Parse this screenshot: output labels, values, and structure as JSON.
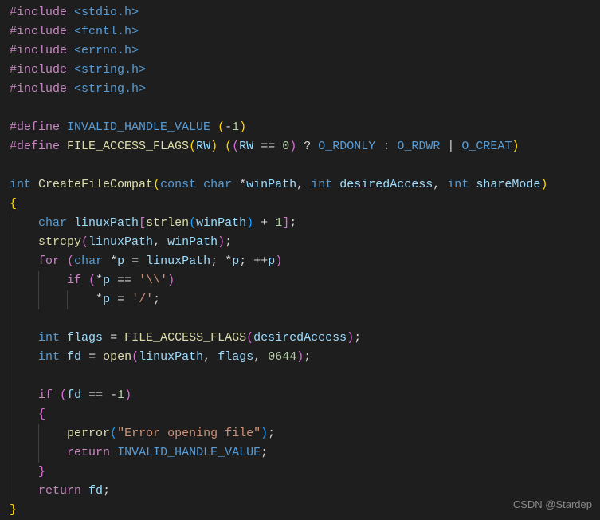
{
  "includes": [
    "<stdio.h>",
    "<fcntl.h>",
    "<errno.h>",
    "<string.h>",
    "<string.h>"
  ],
  "define1": {
    "kw": "#define",
    "name": "INVALID_HANDLE_VALUE",
    "val": "(-1)"
  },
  "define2": {
    "kw": "#define",
    "name": "FILE_ACCESS_FLAGS",
    "param": "RW",
    "cond_l": "RW",
    "cond_op": "==",
    "cond_r": "0",
    "t": "O_RDONLY",
    "f1": "O_RDWR",
    "f2": "O_CREAT"
  },
  "func": {
    "ret": "int",
    "name": "CreateFileCompat",
    "p1t": "const",
    "p1t2": "char",
    "p1n": "winPath",
    "p2t": "int",
    "p2n": "desiredAccess",
    "p3t": "int",
    "p3n": "shareMode",
    "l1_t": "char",
    "l1_v": "linuxPath",
    "l1_fn": "strlen",
    "l1_arg": "winPath",
    "l1_plus": "1",
    "l2_fn": "strcpy",
    "l2_a": "linuxPath",
    "l2_b": "winPath",
    "for_kw": "for",
    "for_t": "char",
    "for_v": "p",
    "for_init": "linuxPath",
    "for_cond": "*p",
    "for_inc": "++p",
    "if1_kw": "if",
    "if1_l": "*p",
    "if1_op": "==",
    "if1_r": "'\\\\'",
    "assign_l": "*p",
    "assign_r": "'/'",
    "l3_t": "int",
    "l3_v": "flags",
    "l3_macro": "FILE_ACCESS_FLAGS",
    "l3_arg": "desiredAccess",
    "l4_t": "int",
    "l4_v": "fd",
    "l4_fn": "open",
    "l4_a": "linuxPath",
    "l4_b": "flags",
    "l4_c": "0644",
    "if2_kw": "if",
    "if2_l": "fd",
    "if2_op": "==",
    "if2_r": "-1",
    "perr_fn": "perror",
    "perr_s": "\"Error opening file\"",
    "ret1_kw": "return",
    "ret1_v": "INVALID_HANDLE_VALUE",
    "ret2_kw": "return",
    "ret2_v": "fd"
  },
  "watermark": "CSDN @Stardep"
}
